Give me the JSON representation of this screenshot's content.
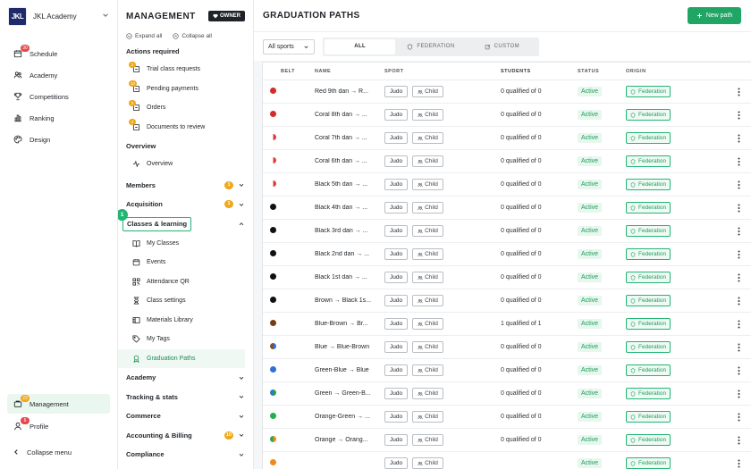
{
  "sidebar": {
    "brand_logo": "JKL",
    "brand_name": "JKL Academy",
    "items": [
      {
        "label": "Schedule",
        "icon": "calendar-icon",
        "badge": "30"
      },
      {
        "label": "Academy",
        "icon": "users-icon",
        "badge": ""
      },
      {
        "label": "Competitions",
        "icon": "trophy-icon",
        "badge": ""
      },
      {
        "label": "Ranking",
        "icon": "bar-chart-icon",
        "badge": ""
      },
      {
        "label": "Design",
        "icon": "palette-icon",
        "badge": ""
      }
    ],
    "management_label": "Management",
    "management_badge": "23",
    "profile_label": "Profile",
    "profile_badge": "6",
    "collapse_label": "Collapse menu"
  },
  "management": {
    "title": "MANAGEMENT",
    "owner_label": "OWNER",
    "expand_all": "Expand all",
    "collapse_all": "Collapse all",
    "actions_title": "Actions required",
    "actions": [
      {
        "label": "Trial class requests",
        "badge": "2"
      },
      {
        "label": "Pending payments",
        "badge": "10"
      },
      {
        "label": "Orders",
        "badge": "3"
      },
      {
        "label": "Documents to review",
        "badge": "2"
      }
    ],
    "overview_title": "Overview",
    "overview_item": "Overview",
    "members_label": "Members",
    "members_badge": "1",
    "acquisition_label": "Acquisition",
    "acquisition_badge": "1",
    "classes_label": "Classes & learning",
    "step_number": "1",
    "classes_items": [
      {
        "label": "My Classes",
        "icon": "book-icon"
      },
      {
        "label": "Events",
        "icon": "calendar-icon"
      },
      {
        "label": "Attendance QR",
        "icon": "qr-icon"
      },
      {
        "label": "Class settings",
        "icon": "hourglass-icon"
      },
      {
        "label": "Materials Library",
        "icon": "library-icon"
      },
      {
        "label": "My Tags",
        "icon": "tag-icon"
      },
      {
        "label": "Graduation Paths",
        "icon": "medal-icon"
      }
    ],
    "groups_after": [
      {
        "label": "Academy",
        "badge": ""
      },
      {
        "label": "Tracking & stats",
        "badge": ""
      },
      {
        "label": "Commerce",
        "badge": ""
      },
      {
        "label": "Accounting & Billing",
        "badge": "10"
      },
      {
        "label": "Compliance",
        "badge": ""
      }
    ]
  },
  "main": {
    "title": "GRADUATION PATHS",
    "new_button": "New path",
    "sports_filter": "All sports",
    "tabs": [
      "ALL",
      "FEDERATION",
      "CUSTOM"
    ],
    "columns": [
      "BELT",
      "NAME",
      "SPORT",
      "STUDENTS",
      "STATUS",
      "ORIGIN"
    ],
    "rows": [
      {
        "belt": "#d42b2b",
        "belt2": "#d42b2b",
        "name": "Red 9th dan → R...",
        "sport": "Judo",
        "audience": "Child",
        "students": "0 qualified of 0",
        "status": "Active",
        "origin": "Federation"
      },
      {
        "belt": "#d42b2b",
        "belt2": "#d42b2b",
        "name": "Coral 8th dan → ...",
        "sport": "Judo",
        "audience": "Child",
        "students": "0 qualified of 0",
        "status": "Active",
        "origin": "Federation"
      },
      {
        "belt": "#e03a3a",
        "belt2": "#ffffff",
        "name": "Coral 7th dan → ...",
        "sport": "Judo",
        "audience": "Child",
        "students": "0 qualified of 0",
        "status": "Active",
        "origin": "Federation"
      },
      {
        "belt": "#e03a3a",
        "belt2": "#ffffff",
        "name": "Coral 6th dan → ...",
        "sport": "Judo",
        "audience": "Child",
        "students": "0 qualified of 0",
        "status": "Active",
        "origin": "Federation"
      },
      {
        "belt": "#e03a3a",
        "belt2": "#ffffff",
        "name": "Black 5th dan → ...",
        "sport": "Judo",
        "audience": "Child",
        "students": "0 qualified of 0",
        "status": "Active",
        "origin": "Federation"
      },
      {
        "belt": "#111111",
        "belt2": "#111111",
        "name": "Black 4th dan → ...",
        "sport": "Judo",
        "audience": "Child",
        "students": "0 qualified of 0",
        "status": "Active",
        "origin": "Federation"
      },
      {
        "belt": "#111111",
        "belt2": "#111111",
        "name": "Black 3rd dan → ...",
        "sport": "Judo",
        "audience": "Child",
        "students": "0 qualified of 0",
        "status": "Active",
        "origin": "Federation"
      },
      {
        "belt": "#111111",
        "belt2": "#111111",
        "name": "Black 2nd dan → ...",
        "sport": "Judo",
        "audience": "Child",
        "students": "0 qualified of 0",
        "status": "Active",
        "origin": "Federation"
      },
      {
        "belt": "#111111",
        "belt2": "#111111",
        "name": "Black 1st dan → ...",
        "sport": "Judo",
        "audience": "Child",
        "students": "0 qualified of 0",
        "status": "Active",
        "origin": "Federation"
      },
      {
        "belt": "#111111",
        "belt2": "#111111",
        "name": "Brown → Black 1s...",
        "sport": "Judo",
        "audience": "Child",
        "students": "0 qualified of 0",
        "status": "Active",
        "origin": "Federation"
      },
      {
        "belt": "#7a3a12",
        "belt2": "#7a3a12",
        "name": "Blue-Brown → Br...",
        "sport": "Judo",
        "audience": "Child",
        "students": "1 qualified of 1",
        "status": "Active",
        "origin": "Federation"
      },
      {
        "belt": "#2f6fd6",
        "belt2": "#8a4a1c",
        "name": "Blue → Blue-Brown",
        "sport": "Judo",
        "audience": "Child",
        "students": "0 qualified of 0",
        "status": "Active",
        "origin": "Federation"
      },
      {
        "belt": "#2f6fd6",
        "belt2": "#2f6fd6",
        "name": "Green-Blue → Blue",
        "sport": "Judo",
        "audience": "Child",
        "students": "0 qualified of 0",
        "status": "Active",
        "origin": "Federation"
      },
      {
        "belt": "#21a64a",
        "belt2": "#2f6fd6",
        "name": "Green → Green-B...",
        "sport": "Judo",
        "audience": "Child",
        "students": "0 qualified of 0",
        "status": "Active",
        "origin": "Federation"
      },
      {
        "belt": "#21b04a",
        "belt2": "#21b04a",
        "name": "Orange-Green → ...",
        "sport": "Judo",
        "audience": "Child",
        "students": "0 qualified of 0",
        "status": "Active",
        "origin": "Federation"
      },
      {
        "belt": "#f08a1c",
        "belt2": "#21a64a",
        "name": "Orange → Orang...",
        "sport": "Judo",
        "audience": "Child",
        "students": "0 qualified of 0",
        "status": "Active",
        "origin": "Federation"
      },
      {
        "belt": "#f08a1c",
        "belt2": "#f08a1c",
        "name": "",
        "sport": "Judo",
        "audience": "Child",
        "students": "",
        "status": "Active",
        "origin": "Federation"
      }
    ]
  }
}
